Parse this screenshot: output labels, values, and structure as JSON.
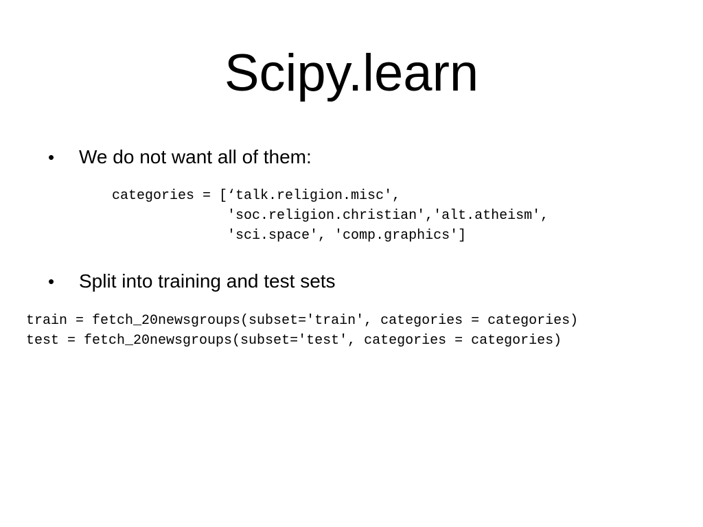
{
  "slide": {
    "title": "Scipy.learn",
    "bullets": [
      {
        "marker": "•",
        "text": "We do not want all of them:"
      },
      {
        "marker": "•",
        "text": "Split into training and test sets"
      }
    ],
    "code_blocks": [
      {
        "lines": [
          "categories = [‘talk.religion.misc',",
          "              'soc.religion.christian','alt.atheism',",
          "              'sci.space', 'comp.graphics']"
        ]
      },
      {
        "lines": [
          "train = fetch_20newsgroups(subset='train', categories = categories)",
          "test = fetch_20newsgroups(subset='test', categories = categories)"
        ]
      }
    ]
  }
}
